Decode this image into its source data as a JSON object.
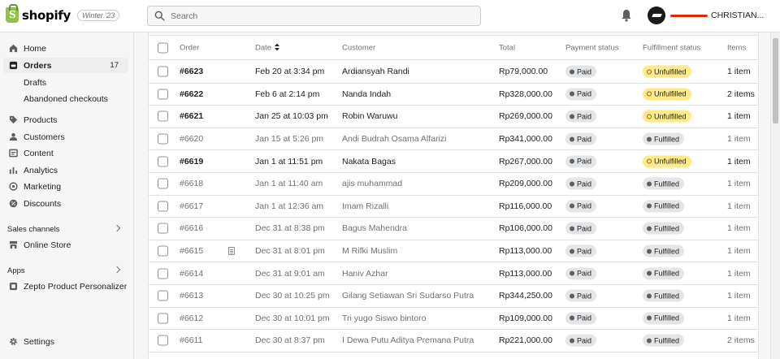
{
  "app": {
    "logo_text": "shopify",
    "version_badge": "Winter '23"
  },
  "search": {
    "placeholder": "Search"
  },
  "user": {
    "name": "CHRISTIAN..."
  },
  "sidebar": {
    "items": [
      {
        "label": "Home",
        "icon": "home-icon"
      },
      {
        "label": "Orders",
        "icon": "orders-icon",
        "count": "17",
        "active": true
      },
      {
        "label": "Products",
        "icon": "tag-icon"
      },
      {
        "label": "Customers",
        "icon": "person-icon"
      },
      {
        "label": "Content",
        "icon": "content-icon"
      },
      {
        "label": "Analytics",
        "icon": "bar-chart-icon"
      },
      {
        "label": "Marketing",
        "icon": "target-icon"
      },
      {
        "label": "Discounts",
        "icon": "discount-icon"
      }
    ],
    "subitems": [
      "Drafts",
      "Abandoned checkouts"
    ],
    "sales_channels_label": "Sales channels",
    "online_store_label": "Online Store",
    "apps_label": "Apps",
    "app_item_label": "Zepto Product Personalizer",
    "settings_label": "Settings"
  },
  "table": {
    "headers": {
      "order": "Order",
      "date": "Date",
      "customer": "Customer",
      "total": "Total",
      "payment": "Payment status",
      "fulfillment": "Fulfillment status",
      "items": "Items"
    },
    "rows": [
      {
        "order": "#6623",
        "date": "Feb 20 at 3:34 pm",
        "customer": "Ardiansyah Randi",
        "total": "Rp79,000.00",
        "payment": "Paid",
        "fulfillment": "Unfulfilled",
        "items": "1 item",
        "unread": true
      },
      {
        "order": "#6622",
        "date": "Feb 6 at 2:14 pm",
        "customer": "Nanda Indah",
        "total": "Rp328,000.00",
        "payment": "Paid",
        "fulfillment": "Unfulfilled",
        "items": "2 items",
        "unread": true
      },
      {
        "order": "#6621",
        "date": "Jan 25 at 10:03 pm",
        "customer": "Robin Waruwu",
        "total": "Rp269,000.00",
        "payment": "Paid",
        "fulfillment": "Unfulfilled",
        "items": "1 item",
        "unread": true
      },
      {
        "order": "#6620",
        "date": "Jan 15 at 5:26 pm",
        "customer": "Andi Budrah Osama Alfarizi",
        "total": "Rp341,000.00",
        "payment": "Paid",
        "fulfillment": "Fulfilled",
        "items": "1 item",
        "unread": false
      },
      {
        "order": "#6619",
        "date": "Jan 1 at 11:51 pm",
        "customer": "Nakata Bagas",
        "total": "Rp267,000.00",
        "payment": "Paid",
        "fulfillment": "Unfulfilled",
        "items": "1 item",
        "unread": true
      },
      {
        "order": "#6618",
        "date": "Jan 1 at 11:40 am",
        "customer": "ajis muhammad",
        "total": "Rp209,000.00",
        "payment": "Paid",
        "fulfillment": "Fulfilled",
        "items": "1 item",
        "unread": false
      },
      {
        "order": "#6617",
        "date": "Jan 1 at 12:36 am",
        "customer": "Imam Rizalli",
        "total": "Rp116,000.00",
        "payment": "Paid",
        "fulfillment": "Fulfilled",
        "items": "1 item",
        "unread": false
      },
      {
        "order": "#6616",
        "date": "Dec 31 at 8:38 pm",
        "customer": "Bagus Mahendra",
        "total": "Rp106,000.00",
        "payment": "Paid",
        "fulfillment": "Fulfilled",
        "items": "1 item",
        "unread": false
      },
      {
        "order": "#6615",
        "date": "Dec 31 at 8:01 pm",
        "customer": "M Rifki Muslim",
        "total": "Rp113,000.00",
        "payment": "Paid",
        "fulfillment": "Fulfilled",
        "items": "1 item",
        "unread": false,
        "has_note": true
      },
      {
        "order": "#6614",
        "date": "Dec 31 at 9:01 am",
        "customer": "Haniv Azhar",
        "total": "Rp113,000.00",
        "payment": "Paid",
        "fulfillment": "Fulfilled",
        "items": "1 item",
        "unread": false
      },
      {
        "order": "#6613",
        "date": "Dec 30 at 10:25 pm",
        "customer": "Gilang Setiawan Sri Sudarso Putra",
        "total": "Rp344,250.00",
        "payment": "Paid",
        "fulfillment": "Fulfilled",
        "items": "1 item",
        "unread": false
      },
      {
        "order": "#6612",
        "date": "Dec 30 at 10:01 pm",
        "customer": "Tri yugo Siswo bintoro",
        "total": "Rp109,000.00",
        "payment": "Paid",
        "fulfillment": "Fulfilled",
        "items": "1 item",
        "unread": false
      },
      {
        "order": "#6611",
        "date": "Dec 30 at 8:37 pm",
        "customer": "I Dewa Putu Aditya Premana Putra",
        "total": "Rp221,000.00",
        "payment": "Paid",
        "fulfillment": "Fulfilled",
        "items": "2 items",
        "unread": false
      }
    ]
  },
  "colors": {
    "brand_green": "#95bf47",
    "unfulfilled_yellow": "#ffea8a",
    "neutral_badge": "#e4e5e7",
    "redaction_red": "#d82c0d"
  }
}
